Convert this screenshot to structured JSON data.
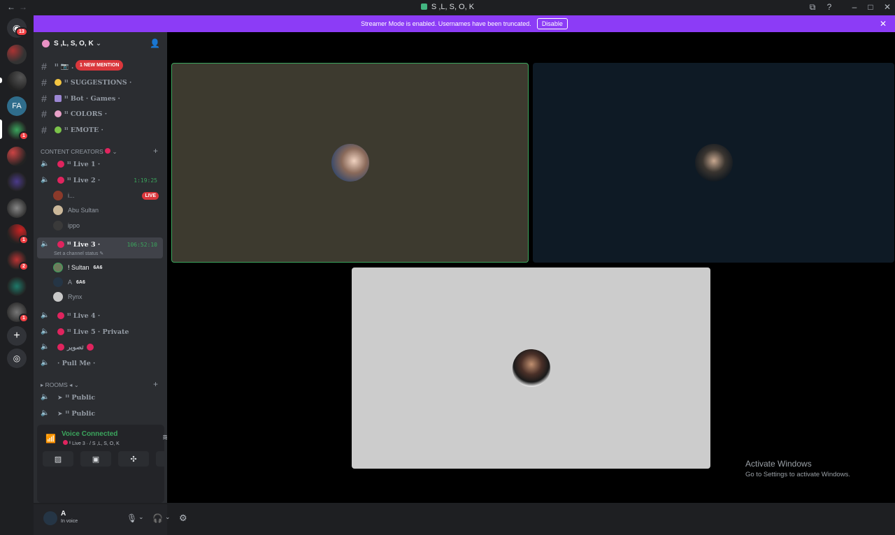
{
  "window": {
    "title": "S ,L, S, O, K",
    "back_icon": "arrow-left-icon",
    "forward_icon": "arrow-right-icon"
  },
  "banner": {
    "text": "Streamer Mode is enabled. Usernames have been truncated.",
    "button": "Disable",
    "color": "#8c3cf6"
  },
  "servers": {
    "home_badge": "13",
    "badges": [
      "1",
      "1",
      "2",
      "1"
    ]
  },
  "sidebar": {
    "server_name": "S ,L, S, O, K",
    "mention_badge": "1 NEW MENTION",
    "text_channels": [
      {
        "label": "ˡˡ 📷 ."
      },
      {
        "label": "ˡˡ SUGGESTIONS ·"
      },
      {
        "label": "ˡˡ Bot · Games ·"
      },
      {
        "label": "ˡˡ COLORS ·"
      },
      {
        "label": "ˡˡ EMOTE ·"
      }
    ],
    "category_content_creators": "CONTENT CREATORS",
    "voice_channels": {
      "live1": "ˡˡ Live 1 ·",
      "live2": "ˡˡ Live 2 ·",
      "live2_timer": "1:19:25",
      "live2_members": [
        "i...",
        "Abu Sultan",
        "ippo"
      ],
      "live_badge": "LIVE",
      "live3": "ˡˡ Live 3 ·",
      "live3_timer": "106:52:10",
      "live3_status": "Set a channel status",
      "live3_members": [
        "! Sultan",
        "A",
        "Rynx"
      ],
      "member_tag": "6A6",
      "live4": "ˡˡ Live 4 ·",
      "live5": "ˡˡ Live 5 · Private",
      "arabic": "تصوير",
      "pullme": "· Pull Me ·"
    },
    "category_rooms": "ROOMS",
    "rooms": [
      "ˡˡ Public",
      "ˡˡ Public"
    ]
  },
  "voice": {
    "status": "Voice Connected",
    "channel": "ˡˡ Live 3 ·",
    "server": "/ S ,L, S, O, K"
  },
  "user": {
    "name": "A",
    "status": "In voice"
  },
  "tiles": [
    {
      "bg": "#3d3a2f",
      "border": "#3ba55d"
    },
    {
      "bg": "#0e1a25"
    },
    {
      "bg": "#cccccc"
    }
  ],
  "watermark": {
    "line1": "Activate Windows",
    "line2": "Go to Settings to activate Windows."
  }
}
